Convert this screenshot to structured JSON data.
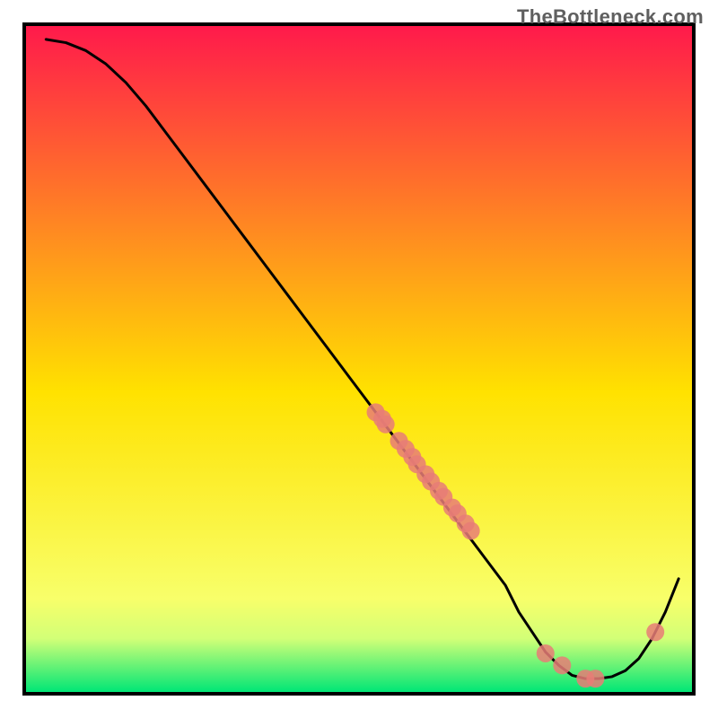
{
  "watermark": "TheBottleneck.com",
  "chart_data": {
    "type": "line",
    "title": "",
    "xlabel": "",
    "ylabel": "",
    "xlim": [
      0,
      100
    ],
    "ylim": [
      0,
      100
    ],
    "grid": false,
    "curve": {
      "name": "bottleneck-curve",
      "x": [
        3,
        6,
        9,
        12,
        15,
        18,
        21,
        24,
        27,
        30,
        33,
        36,
        39,
        42,
        45,
        48,
        51,
        54,
        57,
        60,
        63,
        66,
        69,
        72,
        74,
        76,
        78,
        80,
        82,
        84,
        86,
        88,
        90,
        92,
        94,
        96,
        98
      ],
      "y": [
        98,
        97.5,
        96.3,
        94.3,
        91.5,
        88,
        84,
        80,
        76,
        72,
        68,
        64,
        60,
        56,
        52,
        48,
        44,
        40,
        36,
        32,
        28,
        24,
        20,
        16,
        12,
        9,
        6,
        4,
        2.5,
        2,
        2,
        2.3,
        3.2,
        5,
        8,
        12,
        17
      ]
    },
    "points": {
      "name": "data-markers",
      "x": [
        52.5,
        53.5,
        54.0,
        56.0,
        57.0,
        58.0,
        58.7,
        60.0,
        60.8,
        62.0,
        62.7,
        64.0,
        64.8,
        66.0,
        66.8,
        78.0,
        80.5,
        84.0,
        85.5,
        94.5
      ],
      "y": [
        42.0,
        41.0,
        40.2,
        37.7,
        36.5,
        35.3,
        34.2,
        32.7,
        31.6,
        30.2,
        29.3,
        27.7,
        26.8,
        25.3,
        24.2,
        5.8,
        4.0,
        2.0,
        2.0,
        9.0
      ]
    },
    "background_gradient": {
      "top_color": "#ff1a4b",
      "mid_color": "#fff200",
      "bottom_color": "#00e676"
    },
    "marker_color": "#e77c77",
    "line_color": "#000000"
  }
}
